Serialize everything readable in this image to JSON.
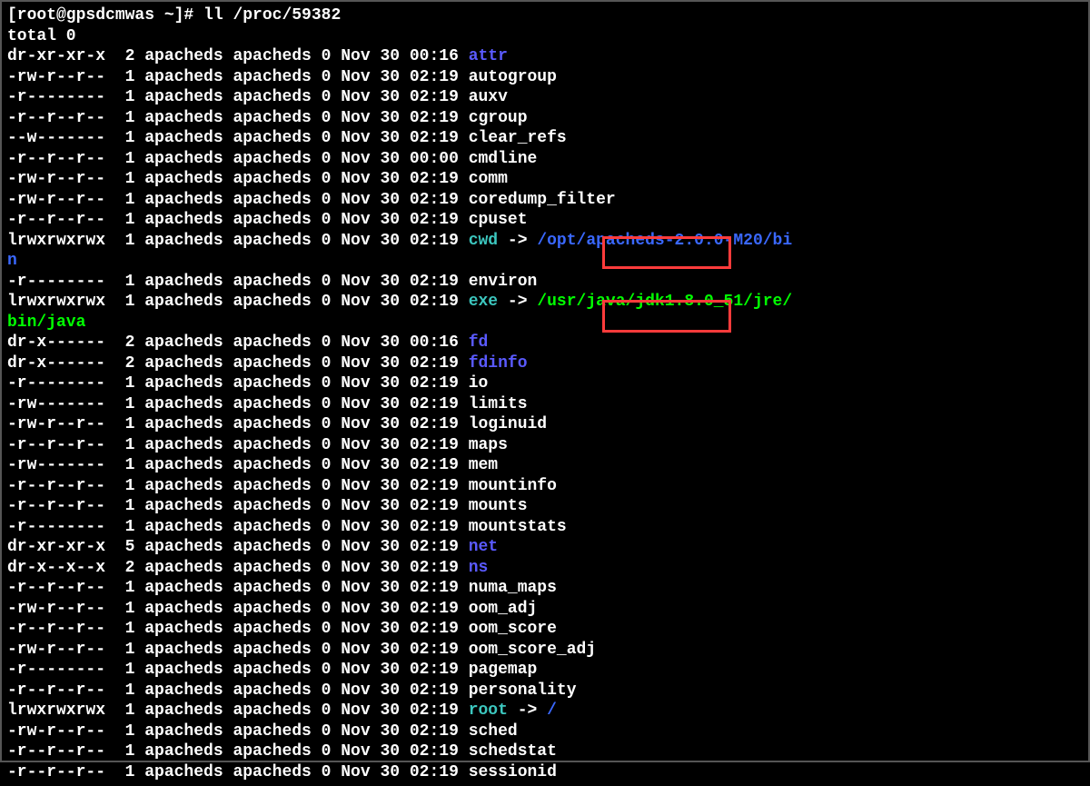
{
  "prompt": "[root@gpsdcmwas ~]# ll /proc/59382",
  "total": "total 0",
  "rows": [
    {
      "perms": "dr-xr-xr-x",
      "nlink": "2",
      "owner": "apacheds",
      "group": "apacheds",
      "size": "0",
      "mon": "Nov",
      "day": "30",
      "time": "00:16",
      "name": "attr",
      "type": "dir"
    },
    {
      "perms": "-rw-r--r--",
      "nlink": "1",
      "owner": "apacheds",
      "group": "apacheds",
      "size": "0",
      "mon": "Nov",
      "day": "30",
      "time": "02:19",
      "name": "autogroup",
      "type": "file"
    },
    {
      "perms": "-r--------",
      "nlink": "1",
      "owner": "apacheds",
      "group": "apacheds",
      "size": "0",
      "mon": "Nov",
      "day": "30",
      "time": "02:19",
      "name": "auxv",
      "type": "file"
    },
    {
      "perms": "-r--r--r--",
      "nlink": "1",
      "owner": "apacheds",
      "group": "apacheds",
      "size": "0",
      "mon": "Nov",
      "day": "30",
      "time": "02:19",
      "name": "cgroup",
      "type": "file"
    },
    {
      "perms": "--w-------",
      "nlink": "1",
      "owner": "apacheds",
      "group": "apacheds",
      "size": "0",
      "mon": "Nov",
      "day": "30",
      "time": "02:19",
      "name": "clear_refs",
      "type": "file"
    },
    {
      "perms": "-r--r--r--",
      "nlink": "1",
      "owner": "apacheds",
      "group": "apacheds",
      "size": "0",
      "mon": "Nov",
      "day": "30",
      "time": "00:00",
      "name": "cmdline",
      "type": "file"
    },
    {
      "perms": "-rw-r--r--",
      "nlink": "1",
      "owner": "apacheds",
      "group": "apacheds",
      "size": "0",
      "mon": "Nov",
      "day": "30",
      "time": "02:19",
      "name": "comm",
      "type": "file"
    },
    {
      "perms": "-rw-r--r--",
      "nlink": "1",
      "owner": "apacheds",
      "group": "apacheds",
      "size": "0",
      "mon": "Nov",
      "day": "30",
      "time": "02:19",
      "name": "coredump_filter",
      "type": "file"
    },
    {
      "perms": "-r--r--r--",
      "nlink": "1",
      "owner": "apacheds",
      "group": "apacheds",
      "size": "0",
      "mon": "Nov",
      "day": "30",
      "time": "02:19",
      "name": "cpuset",
      "type": "file"
    },
    {
      "perms": "lrwxrwxrwx",
      "nlink": "1",
      "owner": "apacheds",
      "group": "apacheds",
      "size": "0",
      "mon": "Nov",
      "day": "30",
      "time": "02:19",
      "name": "cwd",
      "type": "link",
      "arrow": " -> ",
      "target": "/opt/apacheds-2.0.0-M20/bi",
      "wrap": "n",
      "targetclass": "target"
    },
    {
      "perms": "-r--------",
      "nlink": "1",
      "owner": "apacheds",
      "group": "apacheds",
      "size": "0",
      "mon": "Nov",
      "day": "30",
      "time": "02:19",
      "name": "environ",
      "type": "file"
    },
    {
      "perms": "lrwxrwxrwx",
      "nlink": "1",
      "owner": "apacheds",
      "group": "apacheds",
      "size": "0",
      "mon": "Nov",
      "day": "30",
      "time": "02:19",
      "name": "exe",
      "type": "link",
      "arrow": " -> ",
      "target": "/usr/java/jdk1.8.0_51/jre/",
      "wrap": "bin/java",
      "targetclass": "exe"
    },
    {
      "perms": "dr-x------",
      "nlink": "2",
      "owner": "apacheds",
      "group": "apacheds",
      "size": "0",
      "mon": "Nov",
      "day": "30",
      "time": "00:16",
      "name": "fd",
      "type": "dir"
    },
    {
      "perms": "dr-x------",
      "nlink": "2",
      "owner": "apacheds",
      "group": "apacheds",
      "size": "0",
      "mon": "Nov",
      "day": "30",
      "time": "02:19",
      "name": "fdinfo",
      "type": "dir"
    },
    {
      "perms": "-r--------",
      "nlink": "1",
      "owner": "apacheds",
      "group": "apacheds",
      "size": "0",
      "mon": "Nov",
      "day": "30",
      "time": "02:19",
      "name": "io",
      "type": "file"
    },
    {
      "perms": "-rw-------",
      "nlink": "1",
      "owner": "apacheds",
      "group": "apacheds",
      "size": "0",
      "mon": "Nov",
      "day": "30",
      "time": "02:19",
      "name": "limits",
      "type": "file"
    },
    {
      "perms": "-rw-r--r--",
      "nlink": "1",
      "owner": "apacheds",
      "group": "apacheds",
      "size": "0",
      "mon": "Nov",
      "day": "30",
      "time": "02:19",
      "name": "loginuid",
      "type": "file"
    },
    {
      "perms": "-r--r--r--",
      "nlink": "1",
      "owner": "apacheds",
      "group": "apacheds",
      "size": "0",
      "mon": "Nov",
      "day": "30",
      "time": "02:19",
      "name": "maps",
      "type": "file"
    },
    {
      "perms": "-rw-------",
      "nlink": "1",
      "owner": "apacheds",
      "group": "apacheds",
      "size": "0",
      "mon": "Nov",
      "day": "30",
      "time": "02:19",
      "name": "mem",
      "type": "file"
    },
    {
      "perms": "-r--r--r--",
      "nlink": "1",
      "owner": "apacheds",
      "group": "apacheds",
      "size": "0",
      "mon": "Nov",
      "day": "30",
      "time": "02:19",
      "name": "mountinfo",
      "type": "file"
    },
    {
      "perms": "-r--r--r--",
      "nlink": "1",
      "owner": "apacheds",
      "group": "apacheds",
      "size": "0",
      "mon": "Nov",
      "day": "30",
      "time": "02:19",
      "name": "mounts",
      "type": "file"
    },
    {
      "perms": "-r--------",
      "nlink": "1",
      "owner": "apacheds",
      "group": "apacheds",
      "size": "0",
      "mon": "Nov",
      "day": "30",
      "time": "02:19",
      "name": "mountstats",
      "type": "file"
    },
    {
      "perms": "dr-xr-xr-x",
      "nlink": "5",
      "owner": "apacheds",
      "group": "apacheds",
      "size": "0",
      "mon": "Nov",
      "day": "30",
      "time": "02:19",
      "name": "net",
      "type": "dir"
    },
    {
      "perms": "dr-x--x--x",
      "nlink": "2",
      "owner": "apacheds",
      "group": "apacheds",
      "size": "0",
      "mon": "Nov",
      "day": "30",
      "time": "02:19",
      "name": "ns",
      "type": "dir"
    },
    {
      "perms": "-r--r--r--",
      "nlink": "1",
      "owner": "apacheds",
      "group": "apacheds",
      "size": "0",
      "mon": "Nov",
      "day": "30",
      "time": "02:19",
      "name": "numa_maps",
      "type": "file"
    },
    {
      "perms": "-rw-r--r--",
      "nlink": "1",
      "owner": "apacheds",
      "group": "apacheds",
      "size": "0",
      "mon": "Nov",
      "day": "30",
      "time": "02:19",
      "name": "oom_adj",
      "type": "file"
    },
    {
      "perms": "-r--r--r--",
      "nlink": "1",
      "owner": "apacheds",
      "group": "apacheds",
      "size": "0",
      "mon": "Nov",
      "day": "30",
      "time": "02:19",
      "name": "oom_score",
      "type": "file"
    },
    {
      "perms": "-rw-r--r--",
      "nlink": "1",
      "owner": "apacheds",
      "group": "apacheds",
      "size": "0",
      "mon": "Nov",
      "day": "30",
      "time": "02:19",
      "name": "oom_score_adj",
      "type": "file"
    },
    {
      "perms": "-r--------",
      "nlink": "1",
      "owner": "apacheds",
      "group": "apacheds",
      "size": "0",
      "mon": "Nov",
      "day": "30",
      "time": "02:19",
      "name": "pagemap",
      "type": "file"
    },
    {
      "perms": "-r--r--r--",
      "nlink": "1",
      "owner": "apacheds",
      "group": "apacheds",
      "size": "0",
      "mon": "Nov",
      "day": "30",
      "time": "02:19",
      "name": "personality",
      "type": "file"
    },
    {
      "perms": "lrwxrwxrwx",
      "nlink": "1",
      "owner": "apacheds",
      "group": "apacheds",
      "size": "0",
      "mon": "Nov",
      "day": "30",
      "time": "02:19",
      "name": "root",
      "type": "link",
      "arrow": " -> ",
      "target": "/",
      "targetclass": "target"
    },
    {
      "perms": "-rw-r--r--",
      "nlink": "1",
      "owner": "apacheds",
      "group": "apacheds",
      "size": "0",
      "mon": "Nov",
      "day": "30",
      "time": "02:19",
      "name": "sched",
      "type": "file"
    },
    {
      "perms": "-r--r--r--",
      "nlink": "1",
      "owner": "apacheds",
      "group": "apacheds",
      "size": "0",
      "mon": "Nov",
      "day": "30",
      "time": "02:19",
      "name": "schedstat",
      "type": "file"
    },
    {
      "perms": "-r--r--r--",
      "nlink": "1",
      "owner": "apacheds",
      "group": "apacheds",
      "size": "0",
      "mon": "Nov",
      "day": "30",
      "time": "02:19",
      "name": "sessionid",
      "type": "file"
    }
  ]
}
